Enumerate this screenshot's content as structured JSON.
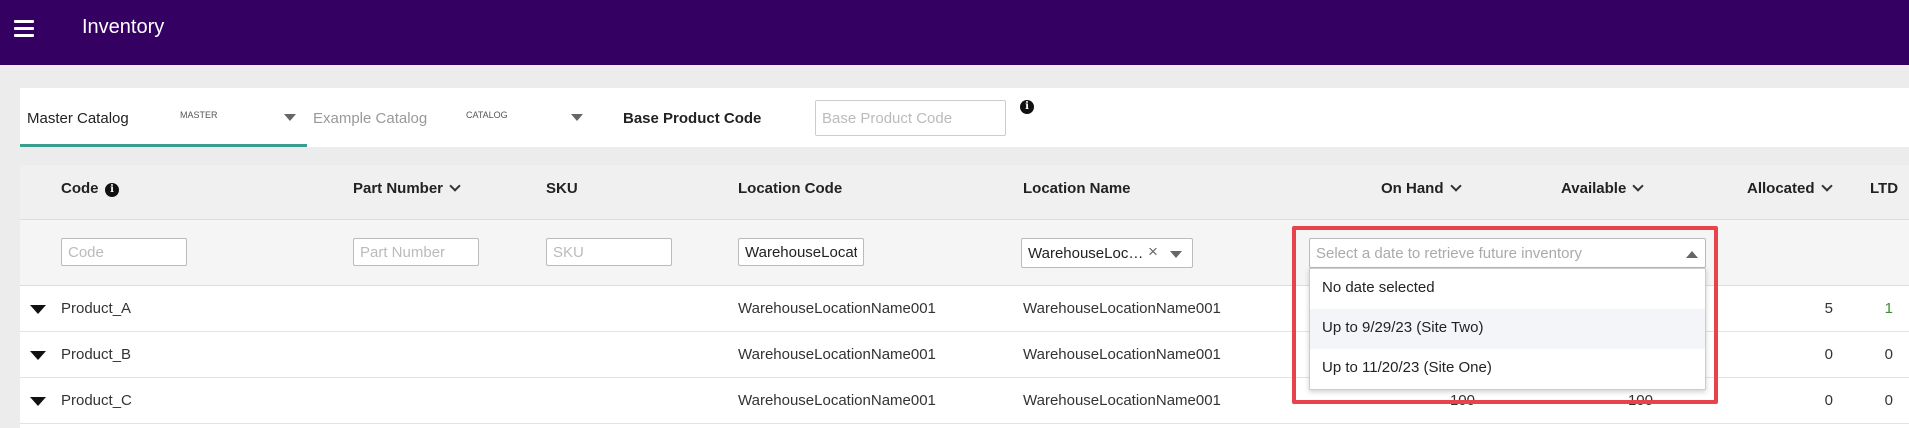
{
  "app": {
    "title": "Inventory"
  },
  "catalogs": [
    {
      "name": "Master Catalog",
      "badge": "MASTER"
    },
    {
      "name": "Example Catalog",
      "badge": "CATALOG"
    }
  ],
  "base_product_code": {
    "label": "Base Product Code",
    "placeholder": "Base Product Code"
  },
  "columns": {
    "code": "Code",
    "part_number": "Part Number",
    "sku": "SKU",
    "location_code": "Location Code",
    "location_name": "Location Name",
    "on_hand": "On Hand",
    "available": "Available",
    "allocated": "Allocated",
    "ltd": "LTD"
  },
  "filters": {
    "code_placeholder": "Code",
    "part_number_placeholder": "Part Number",
    "sku_placeholder": "SKU",
    "location_code_value": "WarehouseLocat",
    "location_name_value": "WarehouseLoca..."
  },
  "date_filter": {
    "placeholder": "Select a date to retrieve future inventory",
    "options": [
      "No date selected",
      "Up to 9/29/23 (Site Two)",
      "Up to 11/20/23 (Site One)"
    ]
  },
  "rows": [
    {
      "code": "Product_A",
      "location_code": "WarehouseLocationName001",
      "location_name": "WarehouseLocationName001",
      "on_hand": "",
      "available": "",
      "allocated": "5",
      "ltd": "1"
    },
    {
      "code": "Product_B",
      "location_code": "WarehouseLocationName001",
      "location_name": "WarehouseLocationName001",
      "on_hand": "",
      "available": "",
      "allocated": "0",
      "ltd": "0"
    },
    {
      "code": "Product_C",
      "location_code": "WarehouseLocationName001",
      "location_name": "WarehouseLocationName001",
      "on_hand": "100",
      "available": "100",
      "allocated": "0",
      "ltd": "0"
    }
  ],
  "colors": {
    "header": "#340062",
    "accent": "#3a9e8f",
    "highlight": "#e8424a",
    "ltd_positive": "#3a8f2a"
  }
}
